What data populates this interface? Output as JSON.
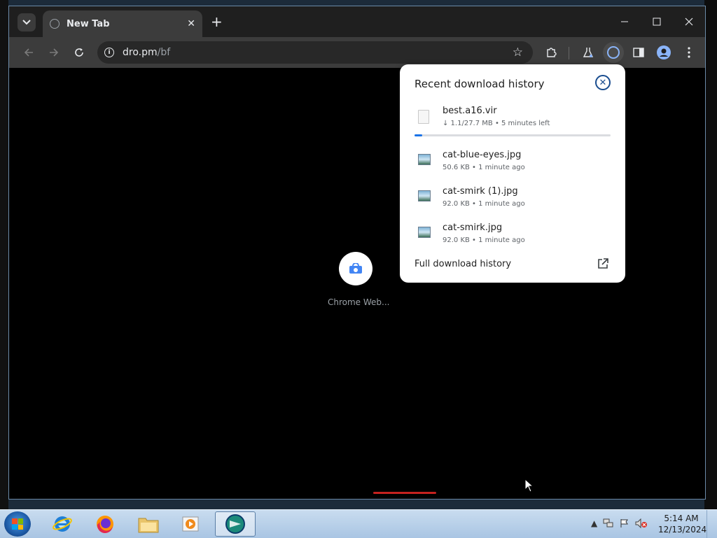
{
  "browser": {
    "tab_title": "New Tab",
    "url_host": "dro.pm",
    "url_path": "/bf"
  },
  "page": {
    "shortcut_label": "Chrome Web..."
  },
  "downloads": {
    "title": "Recent download history",
    "items": [
      {
        "name": "best.a16.vir",
        "meta": "↓ 1.1/27.7 MB • 5 minutes left",
        "type": "generic",
        "progress": 0.04
      },
      {
        "name": "cat-blue-eyes.jpg",
        "meta": "50.6 KB • 1 minute ago",
        "type": "image"
      },
      {
        "name": "cat-smirk (1).jpg",
        "meta": "92.0 KB • 1 minute ago",
        "type": "image"
      },
      {
        "name": "cat-smirk.jpg",
        "meta": "92.0 KB • 1 minute ago",
        "type": "image"
      }
    ],
    "full_history_label": "Full download history"
  },
  "taskbar": {
    "time": "5:14 AM",
    "date": "12/13/2024"
  },
  "colors": {
    "accent": "#1a73e8",
    "close_ring": "#1a4d8f"
  }
}
